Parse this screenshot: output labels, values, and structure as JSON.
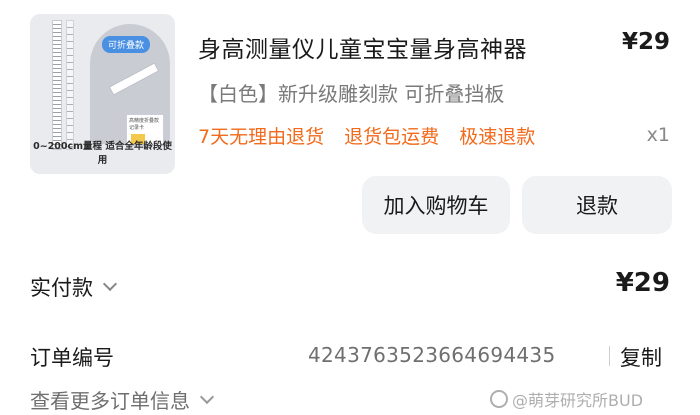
{
  "product": {
    "thumbnail": {
      "badge": "可折叠款",
      "card_text": "高精度折叠款 记录卡",
      "caption": "0~200cm量程 适合全年龄段使用"
    },
    "title": "身高测量仪儿童宝宝量身高神器",
    "price": "¥29",
    "variant": "【白色】新升级雕刻款 可折叠挡板",
    "promos": [
      "7天无理由退货",
      "退货包运费",
      "极速退款"
    ],
    "quantity": "x1"
  },
  "actions": {
    "add_to_cart": "加入购物车",
    "refund": "退款"
  },
  "payment": {
    "label": "实付款",
    "amount": "¥29"
  },
  "order": {
    "number_label": "订单编号",
    "number": "4243763523664694435",
    "copy": "复制",
    "more_info": "查看更多订单信息"
  },
  "watermark": "@萌芽研究所BUD",
  "colors": {
    "promo": "#f26a1b",
    "button_bg": "#f1f2f4"
  }
}
